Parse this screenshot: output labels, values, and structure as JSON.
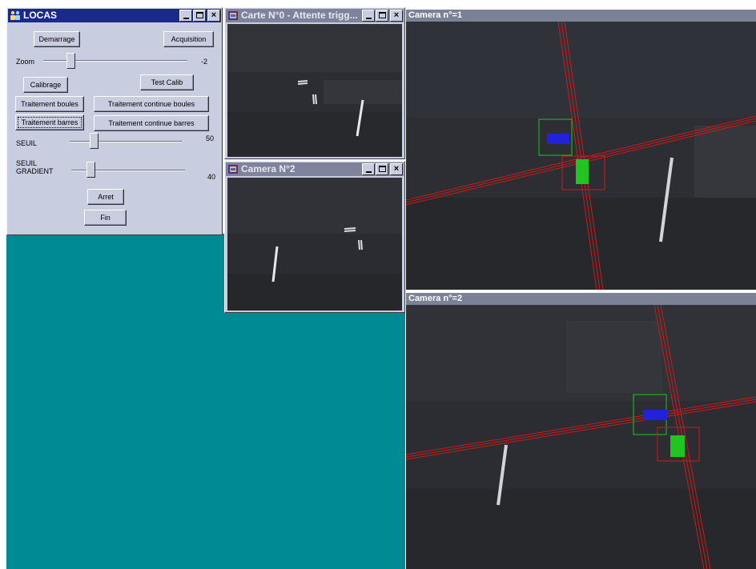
{
  "panel": {
    "title": "LOCAS",
    "buttons": {
      "demarrage": "Demarrage",
      "acquisition": "Acquisition",
      "calibrage": "Calibrage",
      "test_calib": "Test Calib",
      "traitement_boules": "Traitement boules",
      "traitement_continue_boules": "Traitement continue boules",
      "traitement_barres": "Traitement barres",
      "traitement_continue_barres": "Traitement continue barres",
      "arret": "Arret",
      "fin": "Fin"
    },
    "zoom": {
      "label": "Zoom",
      "value": "-2"
    },
    "seuil": {
      "label": "SEUIL",
      "value": "50"
    },
    "seuil_gradient": {
      "label_line1": "SEUIL",
      "label_line2": "GRADIENT",
      "value": "40"
    }
  },
  "windows": {
    "carte": {
      "title": "Carte N°0 - Attente trigg..."
    },
    "camera2_small": {
      "title": "Camera N°2"
    },
    "camera1_view": {
      "title": "Camera n°=1"
    },
    "camera2_view": {
      "title": "Camera n°=2"
    }
  },
  "colors": {
    "active_title": "#1a2a8c",
    "inactive_title": "#7e829a",
    "desktop": "#008a94",
    "overlay_red": "#d01818",
    "overlay_green": "#22c422",
    "overlay_blue": "#2222dd"
  },
  "icons": {
    "panel_icon": "people-icon",
    "camera_icon": "film-icon"
  }
}
